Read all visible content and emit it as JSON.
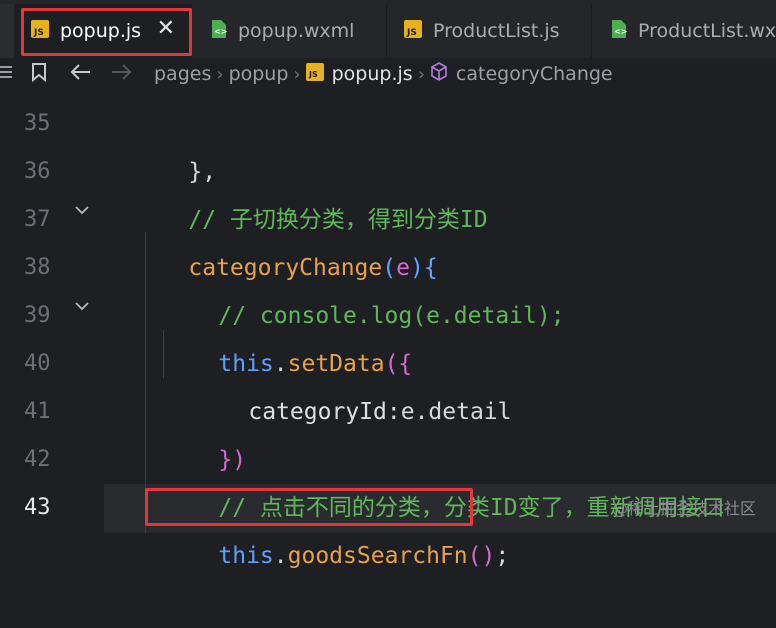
{
  "tabs": [
    {
      "label": "popup.js",
      "type": "js"
    },
    {
      "label": "popup.wxml",
      "type": "wxml"
    },
    {
      "label": "ProductList.js",
      "type": "js"
    },
    {
      "label": "ProductList.wxml",
      "type": "wxml"
    }
  ],
  "breadcrumb": {
    "items": [
      "pages",
      "popup",
      "popup.js",
      "categoryChange"
    ]
  },
  "editor": {
    "current_line": "43",
    "lines": [
      {
        "num": "35",
        "code": "  },"
      },
      {
        "num": "36",
        "code": "  // 子切换分类，得到分类ID"
      },
      {
        "num": "37",
        "code": "  categoryChange(e){"
      },
      {
        "num": "38",
        "code": "    // console.log(e.detail);"
      },
      {
        "num": "39",
        "code": "    this.setData({"
      },
      {
        "num": "40",
        "code": "      categoryId:e.detail"
      },
      {
        "num": "41",
        "code": "    })"
      },
      {
        "num": "42",
        "code": "    // 点击不同的分类，分类ID变了，重新调用接口"
      },
      {
        "num": "43",
        "code": "    this.goodsSearchFn();"
      }
    ]
  },
  "watermark": "@稀土掘金技术社区",
  "colors": {
    "highlight": "#e0383c",
    "comment": "#5fb85a",
    "function": "#e7a24a",
    "keyword": "#5fa0ff"
  }
}
